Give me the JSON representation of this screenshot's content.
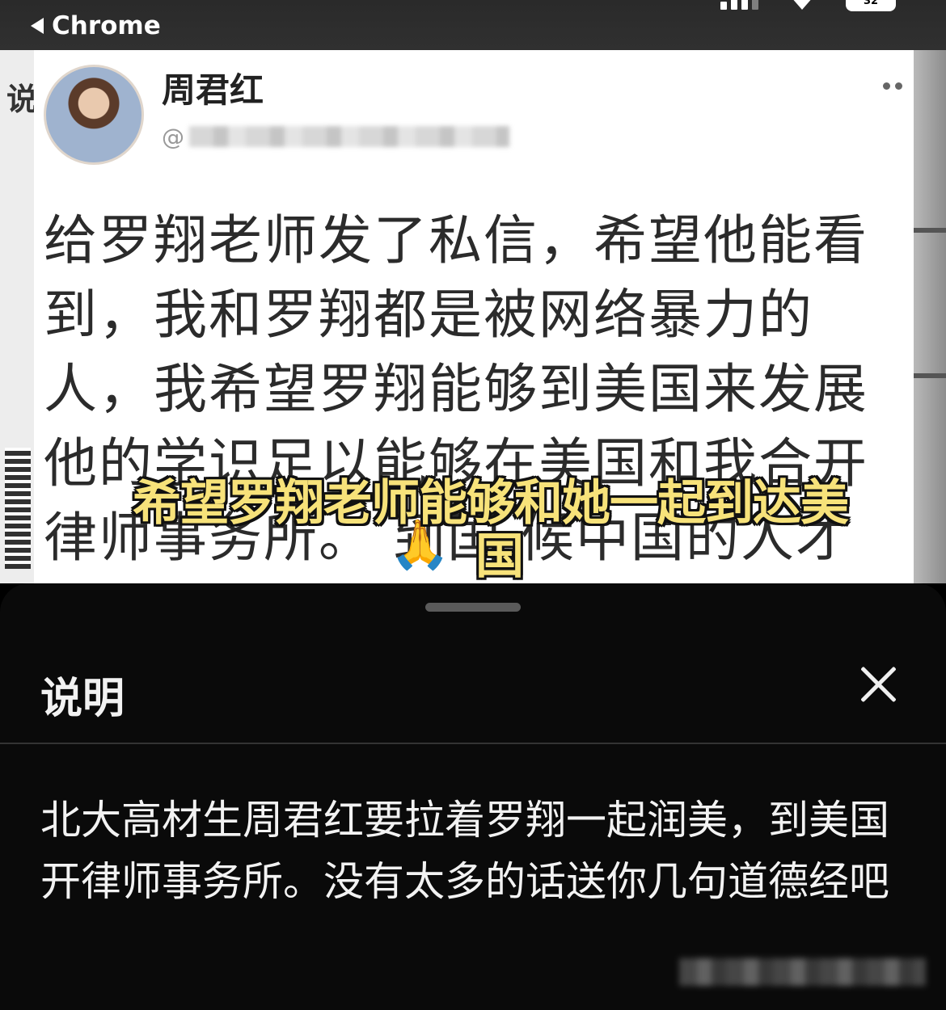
{
  "status_bar": {
    "back_label": "Chrome",
    "battery_text": "32"
  },
  "post": {
    "author_name": "周君红",
    "handle_prefix": "@",
    "text_lines": [
      "给罗翔老师发了私信，希望他能看",
      "到，我和罗翔都是被网络暴力的",
      "人，我希望罗翔能够到美国来发展",
      "他的学识足以能够在美国和我合开",
      "律师事务所。   到国 候中国的人才"
    ],
    "emoji": "🙏"
  },
  "video_overlay": {
    "side_char": "说",
    "subtitle_line1": "希望罗翔老师能够和她一起到达美",
    "subtitle_line2": "国"
  },
  "sheet": {
    "title": "说明",
    "description": "北大高材生周君红要拉着罗翔一起润美，到美国开律师事务所。没有太多的话送你几句道德经吧"
  },
  "icons": [
    "back-arrow-icon",
    "signal-icon",
    "wifi-icon",
    "battery-icon",
    "more-icon",
    "close-icon",
    "qr-code-icon"
  ]
}
